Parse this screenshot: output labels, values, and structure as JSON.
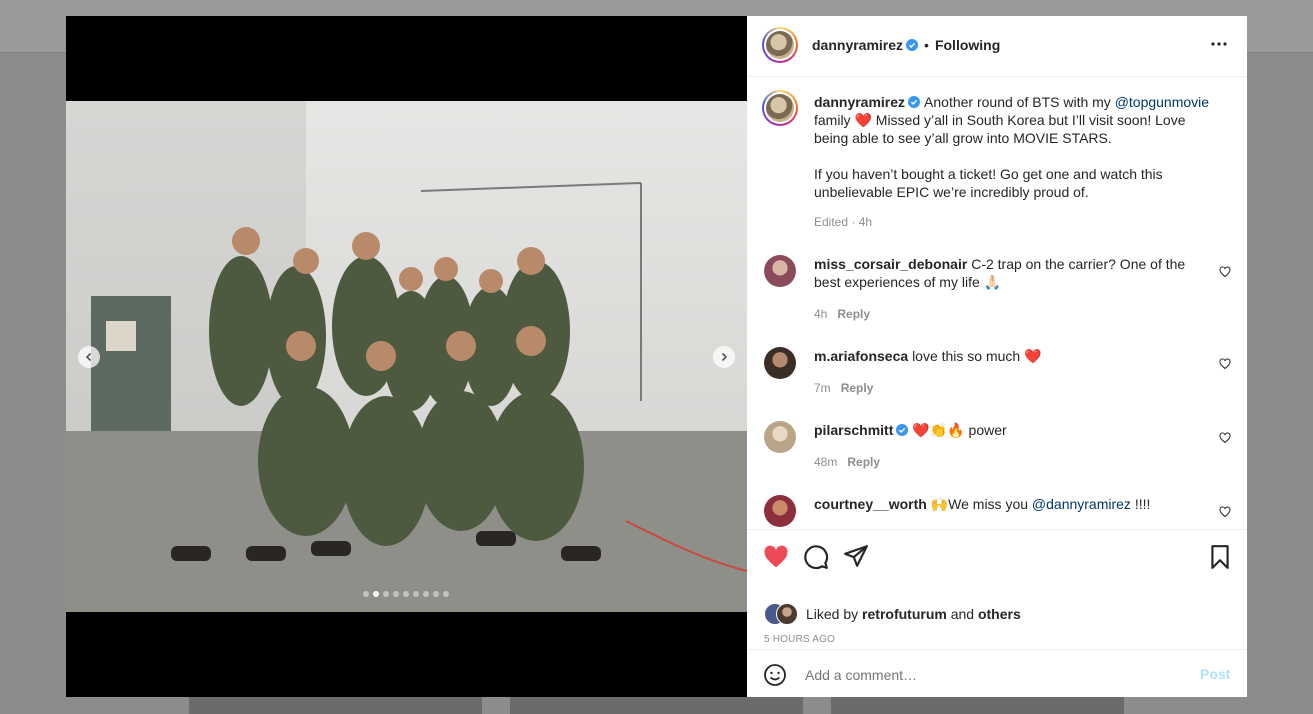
{
  "post": {
    "username": "dannyramirez",
    "follow_status": "Following",
    "caption_part1": "Another round of BTS with my ",
    "caption_mention": "@topgunmovie",
    "caption_part2a": "family ",
    "caption_part2b": " Missed y’all in South Korea but I’ll visit soon! Love being able to see y’all grow into MOVIE STARS.",
    "caption_paragraph2": "If you haven’t bought a ticket! Go get one and watch this unbelievable EPIC we’re incredibly proud of.",
    "caption_meta": "Edited · 4h",
    "liked_by_prefix": "Liked by ",
    "liked_by_user": "retrofuturum",
    "liked_by_and": " and ",
    "liked_by_others": "others",
    "timestamp": "5 HOURS AGO",
    "comment_placeholder": "Add a comment…",
    "post_button": "Post"
  },
  "comments": [
    {
      "user": "miss_corsair_debonair",
      "text": "C-2 trap on the carrier? One of the best experiences of my life 🙏🏻",
      "time": "4h",
      "reply": "Reply"
    },
    {
      "user": "m.ariafonseca",
      "text": "love this so much",
      "time": "7m",
      "reply": "Reply"
    },
    {
      "user": "pilarschmitt",
      "text": " power",
      "time": "48m",
      "reply": "Reply"
    },
    {
      "user": "courtney__worth",
      "text_before": "We miss you ",
      "mention": "@dannyramirez",
      "text_after": " !!!!"
    }
  ],
  "carousel": {
    "count": 9,
    "active_index": 1
  },
  "colors": {
    "like_red": "#ed4956",
    "link_blue": "#00376b",
    "post_disabled": "#b2dffc",
    "verified_blue": "#3897f0"
  },
  "icons": [
    "more-icon",
    "heart-icon",
    "comment-icon",
    "share-icon",
    "bookmark-icon",
    "emoji-icon",
    "chevron-left-icon",
    "chevron-right-icon",
    "verified-icon"
  ]
}
